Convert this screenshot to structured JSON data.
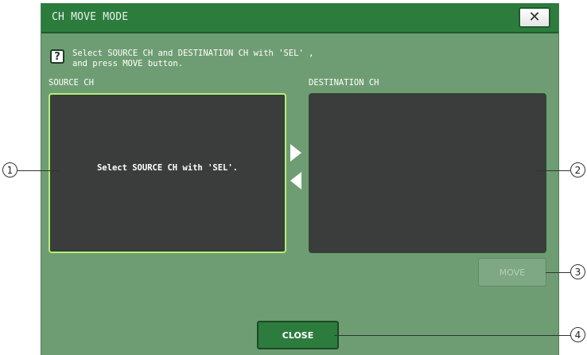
{
  "dialog": {
    "title": "CH MOVE MODE",
    "close_icon": "close-x-icon",
    "help_icon_glyph": "?",
    "instruction_line1": "Select SOURCE CH and DESTINATION CH with 'SEL' ,",
    "instruction_line2": "and press MOVE button.",
    "source_label": "SOURCE CH",
    "destination_label": "DESTINATION CH",
    "source_message": "Select SOURCE CH with 'SEL'.",
    "move_button_label": "MOVE",
    "close_button_label": "CLOSE"
  },
  "callouts": [
    "1",
    "2",
    "3",
    "4"
  ],
  "colors": {
    "titlebar": "#2c7c3e",
    "dialog_bg": "#6f9d73",
    "panel_bg": "#3a3d3b",
    "source_highlight": "#b9ec7a"
  }
}
